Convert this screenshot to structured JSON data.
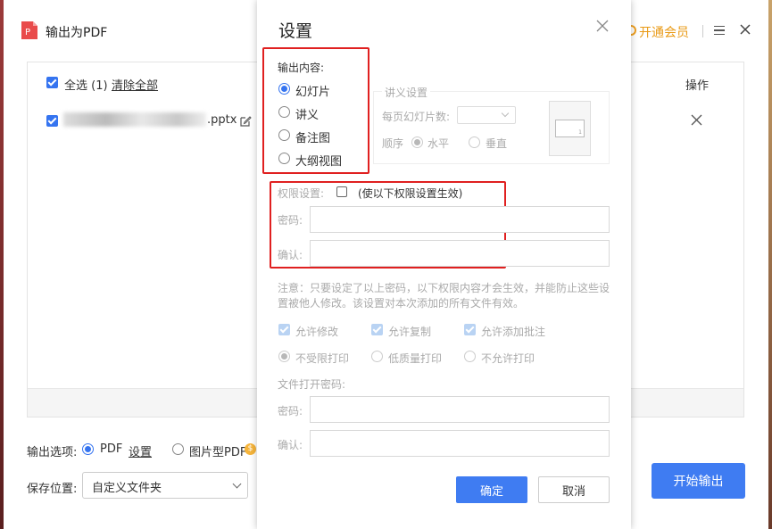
{
  "window": {
    "title": "输出为PDF",
    "vip_label": "开通会员"
  },
  "file_list": {
    "select_all_label": "全选 (1)",
    "clear_all_label": "清除全部",
    "ops_header": "操作",
    "file_ext": ".pptx"
  },
  "footer": {
    "output_options_label": "输出选项:",
    "pdf_label": "PDF",
    "settings_link": "设置",
    "image_pdf_label": "图片型PDF",
    "coin_symbol": "$",
    "save_location_label": "保存位置:",
    "save_location_value": "自定义文件夹",
    "start_button": "开始输出"
  },
  "dialog": {
    "title": "设置",
    "output_content_label": "输出内容:",
    "content_options": [
      "幻灯片",
      "讲义",
      "备注图",
      "大纲视图"
    ],
    "selected_content": "幻灯片",
    "handout_settings_label": "讲义设置",
    "slides_per_page_label": "每页幻灯片数:",
    "preview_page_number": "1",
    "order_label": "顺序",
    "order_horizontal": "水平",
    "order_vertical": "垂直",
    "permission_label": "权限设置:",
    "permission_hint": "(使以下权限设置生效)",
    "password_label": "密码:",
    "confirm_label": "确认:",
    "note_line1": "注意：只要设定了以上密码，以下权限内容才会生效，并能防止这些设",
    "note_line2": "置被他人修改。该设置对本次添加的所有文件有效。",
    "allow_modify": "允许修改",
    "allow_copy": "允许复制",
    "allow_annotate": "允许添加批注",
    "print_unlimited": "不受限打印",
    "print_low": "低质量打印",
    "print_none": "不允许打印",
    "open_password_label": "文件打开密码:",
    "open_password_field_label": "密码:",
    "open_confirm_field_label": "确认:",
    "ok_button": "确定",
    "cancel_button": "取消"
  },
  "colors": {
    "accent": "#3f7cf2",
    "vip": "#e99a16",
    "highlight_box": "#e02020"
  }
}
